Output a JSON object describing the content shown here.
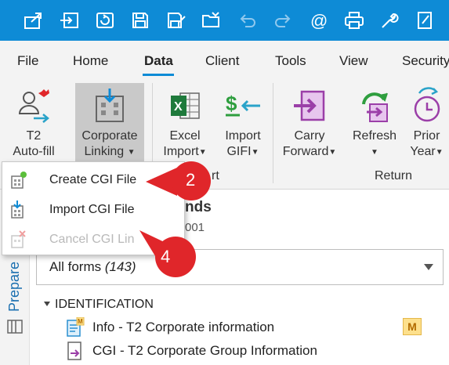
{
  "quick_access": [
    {
      "icon": "export-icon"
    },
    {
      "icon": "import-icon"
    },
    {
      "icon": "sync-icon"
    },
    {
      "icon": "save-icon"
    },
    {
      "icon": "save-as-icon"
    },
    {
      "icon": "open-folder-icon"
    },
    {
      "icon": "undo-icon"
    },
    {
      "icon": "redo-icon"
    },
    {
      "icon": "email-icon"
    },
    {
      "icon": "print-icon"
    },
    {
      "icon": "wrench-icon"
    },
    {
      "icon": "edit-icon"
    }
  ],
  "tabs": [
    "File",
    "Home",
    "Data",
    "Client",
    "Tools",
    "View",
    "Security"
  ],
  "active_tab": "Data",
  "ribbon": {
    "t2_autofill": {
      "line1": "T2",
      "line2": "Auto-fill"
    },
    "corporate_linking": {
      "line1": "Corporate",
      "line2": "Linking"
    },
    "excel_import": {
      "line1": "Excel",
      "line2": "Import"
    },
    "import_gifi": {
      "line1": "Import",
      "line2": "GIFI"
    },
    "carry_forward": {
      "line1": "Carry",
      "line2": "Forward"
    },
    "refresh": {
      "line1": "Refresh",
      "line2": ""
    },
    "prior_year": {
      "line1": "Prior",
      "line2": "Year"
    },
    "group_import": "rt",
    "group_return": "Return"
  },
  "dropdown": {
    "items": [
      {
        "label": "Create CGI File",
        "enabled": true
      },
      {
        "label": "Import CGI File",
        "enabled": true
      },
      {
        "label": "Cancel CGI Lin",
        "enabled": false
      }
    ]
  },
  "callouts": [
    "2",
    "4"
  ],
  "content": {
    "title": "nds",
    "subtitle": "001",
    "side_label": "Prepare",
    "form_selector": {
      "text": "All forms",
      "count": "(143)"
    },
    "section": "IDENTIFICATION",
    "rows": [
      {
        "label": "Info - T2 Corporate information",
        "badge": "M"
      },
      {
        "label": "CGI - T2 Corporate Group Information"
      }
    ]
  },
  "colors": {
    "accent": "#0e8bd6",
    "callout": "#e0262a",
    "purple": "#9b3fa8",
    "green": "#2e9e3e"
  }
}
